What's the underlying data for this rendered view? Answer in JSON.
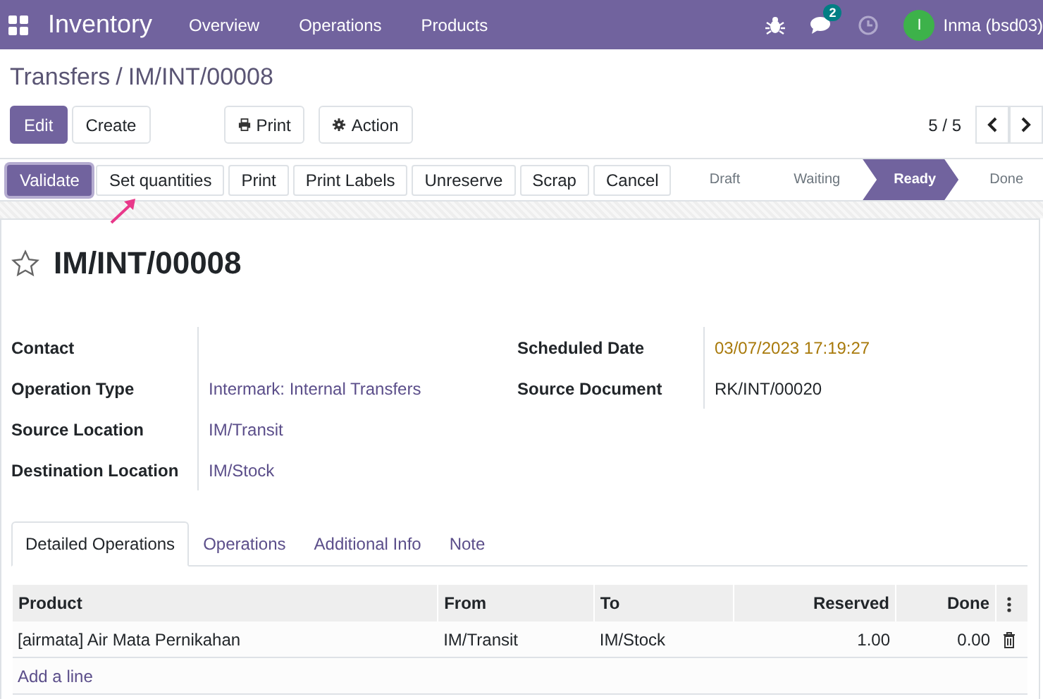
{
  "navbar": {
    "app_title": "Inventory",
    "menu": [
      "Overview",
      "Operations",
      "Products"
    ],
    "message_count": "2",
    "avatar_letter": "I",
    "user": "Inma (bsd03)"
  },
  "breadcrumb": {
    "items": [
      "Transfers",
      "IM/INT/00008"
    ],
    "separator": "/"
  },
  "control_panel": {
    "buttons": [
      {
        "label": "Edit",
        "kind": "primary"
      },
      {
        "label": "Create",
        "kind": "secondary"
      }
    ],
    "print_label": "Print",
    "action_label": "Action",
    "pager": "5 / 5"
  },
  "status_bar": {
    "buttons": [
      {
        "label": "Validate",
        "kind": "primary"
      },
      {
        "label": "Set quantities",
        "kind": "secondary"
      },
      {
        "label": "Print",
        "kind": "secondary"
      },
      {
        "label": "Print Labels",
        "kind": "secondary"
      },
      {
        "label": "Unreserve",
        "kind": "secondary"
      },
      {
        "label": "Scrap",
        "kind": "secondary"
      },
      {
        "label": "Cancel",
        "kind": "secondary"
      }
    ],
    "stages": [
      {
        "label": "Draft",
        "selected": false
      },
      {
        "label": "Waiting",
        "selected": false
      },
      {
        "label": "Ready",
        "selected": true
      },
      {
        "label": "Done",
        "selected": false
      }
    ]
  },
  "form": {
    "title": "IM/INT/00008",
    "starred": false,
    "left_fields": [
      {
        "label": "Contact",
        "kind": "plain"
      },
      {
        "label": "Operation Type",
        "value": "Intermark: Internal Transfers",
        "kind": "link"
      },
      {
        "label": "Source Location",
        "value": "IM/Transit",
        "kind": "link"
      },
      {
        "label": "Destination Location",
        "value": "IM/Stock",
        "kind": "link"
      }
    ],
    "right_fields": [
      {
        "label": "Scheduled Date",
        "value": "03/07/2023 17:19:27",
        "kind": "date"
      },
      {
        "label": "Source Document",
        "value": "RK/INT/00020",
        "kind": "plain"
      }
    ]
  },
  "tabs": [
    {
      "label": "Detailed Operations",
      "selected": true
    },
    {
      "label": "Operations",
      "selected": false
    },
    {
      "label": "Additional Info",
      "selected": false
    },
    {
      "label": "Note",
      "selected": false
    }
  ],
  "table": {
    "columns": [
      {
        "label": "Product",
        "kind": "text"
      },
      {
        "label": "From",
        "kind": "text"
      },
      {
        "label": "To",
        "kind": "text"
      },
      {
        "label": "Reserved",
        "kind": "number"
      },
      {
        "label": "Done",
        "kind": "number"
      }
    ],
    "rows": [
      {
        "cells": [
          "[airmata] Air Mata Pernikahan",
          "IM/Transit",
          "IM/Stock",
          "1.00",
          "0.00"
        ]
      }
    ],
    "add_line": "Add a line"
  }
}
